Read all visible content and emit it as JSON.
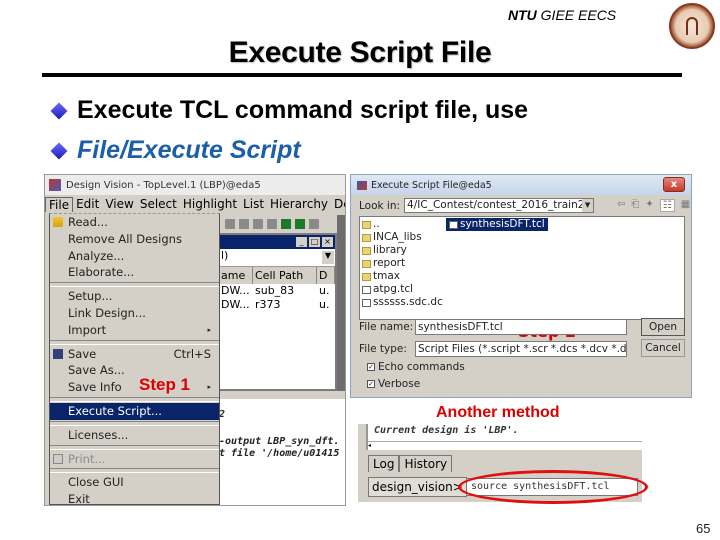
{
  "header": {
    "org_bold": "NTU",
    "org_rest": " GIEE EECS",
    "logo": "ntu-seal-logo"
  },
  "title": "Execute Script File",
  "bullets": [
    {
      "icon": "diamond-bullet-icon",
      "text": "Execute TCL command script file, use"
    },
    {
      "icon": "diamond-bullet-icon",
      "text": "File/Execute Script"
    }
  ],
  "design_vision": {
    "window_title": "Design Vision - TopLevel.1 (LBP)@eda5",
    "menubar": [
      "File",
      "Edit",
      "View",
      "Select",
      "Highlight",
      "List",
      "Hierarchy",
      "De"
    ],
    "inner_window": {
      "combo_value": "l)",
      "columns": [
        "ame",
        "Cell Path",
        "D"
      ],
      "rows": [
        [
          "DW...",
          "sub_83",
          "u."
        ],
        [
          "DW...",
          "r373",
          "u."
        ]
      ]
    },
    "file_menu": [
      {
        "label": "Read...",
        "icon": "folder-open-icon"
      },
      {
        "label": "Remove All Designs"
      },
      {
        "label": "Analyze..."
      },
      {
        "label": "Elaborate..."
      },
      {
        "separator": true
      },
      {
        "label": "Setup..."
      },
      {
        "label": "Link Design..."
      },
      {
        "label": "Import",
        "submenu": true
      },
      {
        "separator": true
      },
      {
        "label": "Save",
        "shortcut": "Ctrl+S",
        "icon": "save-icon"
      },
      {
        "label": "Save As..."
      },
      {
        "label": "Save Info",
        "submenu": true
      },
      {
        "separator": true
      },
      {
        "label": "Execute Script...",
        "selected": true
      },
      {
        "separator": true
      },
      {
        "label": "Licenses..."
      },
      {
        "separator": true
      },
      {
        "label": "Print...",
        "disabled": true,
        "icon": "print-icon"
      },
      {
        "separator": true
      },
      {
        "label": "Close GUI"
      },
      {
        "label": "Exit"
      }
    ],
    "console_lines": [
      "2",
      "-output LBP_syn_dft.",
      "t file '/home/u01415"
    ]
  },
  "step1_label": "Step 1",
  "dialog": {
    "title": "Execute Script File@eda5",
    "close_label": "x",
    "look_in_label": "Look in:",
    "look_in_value": "4/IC_Contest/contest_2016_train2/",
    "files": [
      {
        "name": "..",
        "type": "folder"
      },
      {
        "name": "INCA_libs",
        "type": "folder"
      },
      {
        "name": "library",
        "type": "folder"
      },
      {
        "name": "report",
        "type": "folder"
      },
      {
        "name": "tmax",
        "type": "folder"
      },
      {
        "name": "atpg.tcl",
        "type": "file"
      },
      {
        "name": "ssssss.sdc.dc",
        "type": "file"
      },
      {
        "name": "synthesisDFT.tcl",
        "type": "file",
        "selected": true
      }
    ],
    "file_name_label": "File name:",
    "file_name_value": "synthesisDFT.tcl",
    "file_type_label": "File type:",
    "file_type_value": "Script Files (*.script *.scr *.dcs *.dcv *.dc",
    "open_label": "Open",
    "cancel_label": "Cancel",
    "echo_label": "Echo commands",
    "echo_checked": true,
    "verbose_label": "Verbose",
    "verbose_checked": true
  },
  "step2_label": "Step 2",
  "another_method_label": "Another method",
  "console": {
    "log_line": "Current design is 'LBP'.",
    "tabs": [
      "Log",
      "History"
    ],
    "prompt": "design_vision>",
    "command": "source synthesisDFT.tcl"
  },
  "page_number": "65",
  "colors": {
    "highlight_red": "#dd0000",
    "menu_selected": "#0a246a",
    "bullet_blue": "#1d5fa6"
  }
}
